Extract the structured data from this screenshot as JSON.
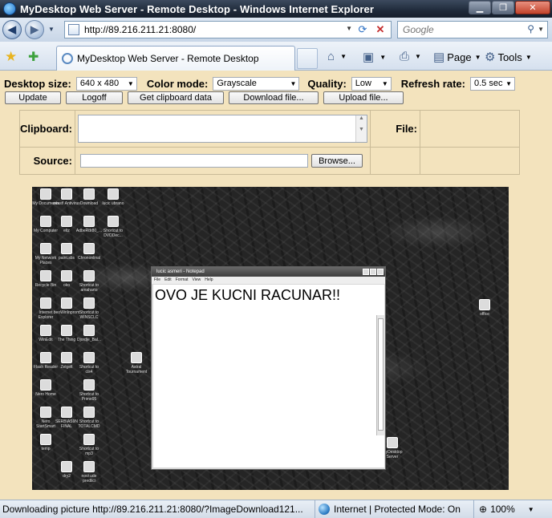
{
  "window": {
    "title": "MyDesktop Web Server - Remote Desktop - Windows Internet Explorer",
    "controls": [
      "▁",
      "❐",
      "✕"
    ]
  },
  "address": {
    "url": "http://89.216.211.21:8080/"
  },
  "search": {
    "placeholder": "Google"
  },
  "tab": {
    "title": "MyDesktop Web Server - Remote Desktop"
  },
  "commands": {
    "page": "Page",
    "tools": "Tools"
  },
  "settings": {
    "desktop_size": {
      "label": "Desktop size:",
      "value": "640 x 480"
    },
    "color_mode": {
      "label": "Color mode:",
      "value": "Grayscale"
    },
    "quality": {
      "label": "Quality:",
      "value": "Low"
    },
    "refresh_rate": {
      "label": "Refresh rate:",
      "value": "0.5 sec"
    }
  },
  "buttons": {
    "update": "Update",
    "logoff": "Logoff",
    "get_clipboard": "Get clipboard data",
    "download": "Download file...",
    "upload": "Upload file..."
  },
  "form": {
    "clipboard_label": "Clipboard:",
    "file_label": "File:",
    "source_label": "Source:",
    "browse": "Browse..."
  },
  "remote": {
    "icons": [
      "My Documents",
      "avast! Antivirus",
      "Download",
      "lucic ubrano",
      "My Computer",
      "eltz",
      "AdbeRdr80_...",
      "Shortcut to DVDDec...",
      "My Network Places",
      "paint.sbs",
      "Chrononlinal",
      "Recycle Bin",
      "oko",
      "Shortcut to amaharto",
      "Internet Explorer",
      "beoWinInprom",
      "Shortcut to WINSCLC",
      "WinEdit",
      "The Thing",
      "Djordje_Bal...",
      "Flash Reader",
      "Zelgelt",
      "Shortcut to cis4",
      "Astral Tournament",
      "Nero Home",
      "Shortcut to Prime95",
      "Nero StartSmart",
      "SERBIAS9N FINAL",
      "Shortcut to TOTALCMD",
      "temp",
      "Shortcut to mp3",
      "dry2",
      "novi ude predlici",
      "office",
      "MyDesktop Server"
    ],
    "notepad": {
      "title": "lucic asmeri - Notepad",
      "menu": [
        "File",
        "Edit",
        "Format",
        "View",
        "Help"
      ],
      "text": "OVO JE KUCNI RACUNAR!!"
    }
  },
  "status": {
    "text": "Downloading picture http://89.216.211.21:8080/?ImageDownload121...",
    "zone": "Internet | Protected Mode: On",
    "zoom": "100%"
  }
}
